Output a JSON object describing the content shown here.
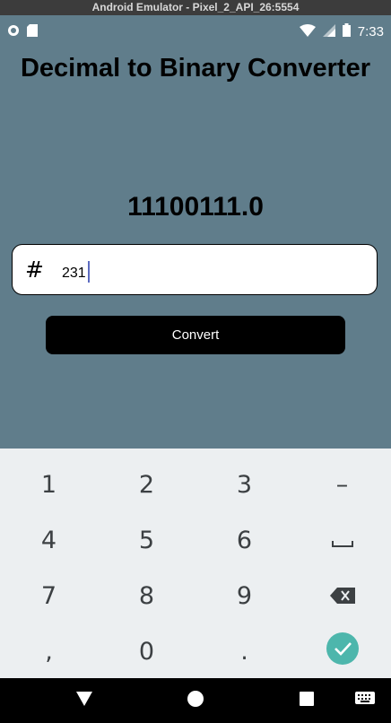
{
  "window": {
    "title": "Android Emulator - Pixel_2_API_26:5554"
  },
  "status_bar": {
    "time": "7:33"
  },
  "app": {
    "title": "Decimal to Binary Converter",
    "result": "11100111.0",
    "input": {
      "prefix": "#",
      "value": "231"
    },
    "convert_label": "Convert"
  },
  "keyboard": {
    "rows": [
      [
        "1",
        "2",
        "3",
        "–"
      ],
      [
        "4",
        "5",
        "6",
        "space-icon"
      ],
      [
        "7",
        "8",
        "9",
        "backspace-icon"
      ],
      [
        ",",
        "0",
        ".",
        "done-icon"
      ]
    ],
    "done_color": "#4DB6AC"
  }
}
